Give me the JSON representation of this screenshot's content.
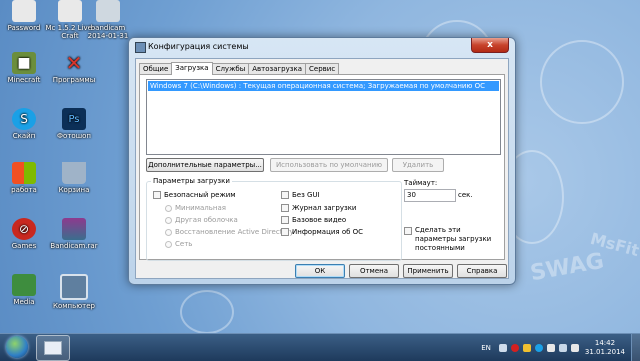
{
  "desktop": {
    "icons": [
      {
        "label": "Password",
        "icon": "file-icon",
        "color": "#e9e9e9"
      },
      {
        "label": "Mc 1.5.2 Live-Craft",
        "icon": "file-icon",
        "color": "#e9e9e9"
      },
      {
        "label": "bandicam 2014-01-31",
        "icon": "video-icon",
        "color": "#cfd8e0"
      },
      {
        "label": "Minecraft",
        "icon": "minecraft-icon",
        "color": "#6b8e3c"
      },
      {
        "label": "Программы",
        "icon": "x-icon",
        "color": "#d9362b"
      },
      {
        "label": "Скайп",
        "icon": "skype-icon",
        "color": "#1aa0e6"
      },
      {
        "label": "Фотошоп",
        "icon": "photoshop-icon",
        "color": "#0c2f57"
      },
      {
        "label": "работа",
        "icon": "windows-flag-icon",
        "color": "#3a8fd6"
      },
      {
        "label": "Корзина",
        "icon": "recycle-bin-icon",
        "color": "#9fb3c8"
      },
      {
        "label": "Games",
        "icon": "no-sign-icon",
        "color": "#c8281f"
      },
      {
        "label": "Bandicam.rar",
        "icon": "archive-icon",
        "color": "#8e3a8e"
      },
      {
        "label": "Media",
        "icon": "media-icon",
        "color": "#3e8d3e"
      },
      {
        "label": "Компьютер",
        "icon": "computer-icon",
        "color": "#5f7f9f"
      }
    ]
  },
  "wallpaper": {
    "text1": "MsFit",
    "text2": "SWAG"
  },
  "dialog": {
    "title": "Конфигурация системы",
    "close_label": "x",
    "tabs": [
      "Общие",
      "Загрузка",
      "Службы",
      "Автозагрузка",
      "Сервис"
    ],
    "active_tab": "Загрузка",
    "os_entries": [
      "Windows 7 (C:\\Windows) : Текущая операционная система; Загружаемая по умолчанию ОС"
    ],
    "buttons": {
      "advanced": "Дополнительные параметры...",
      "set_default": "Использовать по умолчанию",
      "delete": "Удалить"
    },
    "boot_options": {
      "group_label": "Параметры загрузки",
      "safe_mode": "Безопасный режим",
      "radios": [
        "Минимальная",
        "Другая оболочка",
        "Восстановление Active Directory",
        "Сеть"
      ],
      "right_options": [
        "Без GUI",
        "Журнал загрузки",
        "Базовое видео",
        "Информация об ОС"
      ]
    },
    "timeout": {
      "label": "Таймаут:",
      "value": "30",
      "unit": "сек."
    },
    "make_permanent": "Сделать эти параметры загрузки постоянными",
    "footer": {
      "ok": "ОК",
      "cancel": "Отмена",
      "apply": "Применить",
      "help": "Справка"
    }
  },
  "taskbar": {
    "language": "EN",
    "time": "14:42",
    "date": "31.01.2014"
  }
}
